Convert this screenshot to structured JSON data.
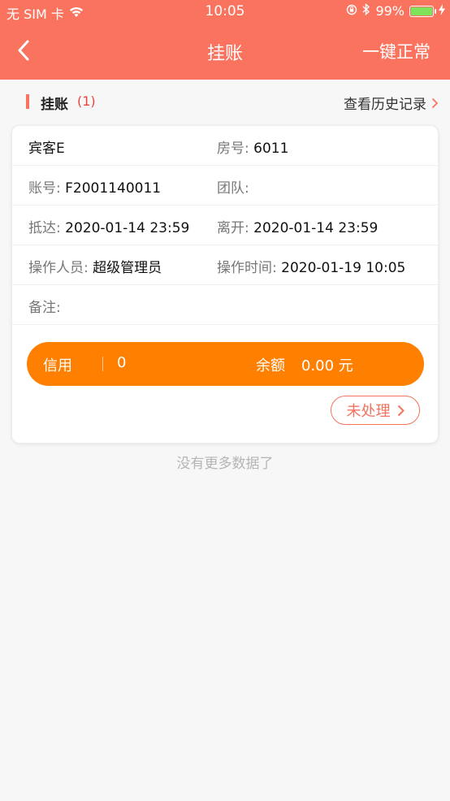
{
  "status_bar": {
    "carrier": "无 SIM 卡",
    "time": "10:05",
    "battery": "99%",
    "battery_level": 0.99
  },
  "nav": {
    "title": "挂账",
    "action": "一键正常"
  },
  "section": {
    "title": "挂账",
    "count": "(1)",
    "history_link": "查看历史记录"
  },
  "record": {
    "guest": "宾客E",
    "room_label": "房号:",
    "room_value": "6011",
    "account_label": "账号:",
    "account_value": "F2001140011",
    "group_label": "团队:",
    "group_value": "",
    "arrive_label": "抵达:",
    "arrive_value": "2020-01-14 23:59",
    "depart_label": "离开:",
    "depart_value": "2020-01-14 23:59",
    "operator_label": "操作人员:",
    "operator_value": "超级管理员",
    "optime_label": "操作时间:",
    "optime_value": "2020-01-19 10:05",
    "remark_label": "备注:",
    "remark_value": "",
    "credit_label": "信用",
    "credit_value": "0",
    "balance_label": "余额",
    "balance_value": "0.00 元",
    "status_button": "未处理"
  },
  "footer": {
    "no_more": "没有更多数据了"
  },
  "colors": {
    "header": "#f9735f",
    "credit_bar": "#ff7f00",
    "status_button": "#f4735f",
    "count": "#e8453c"
  }
}
